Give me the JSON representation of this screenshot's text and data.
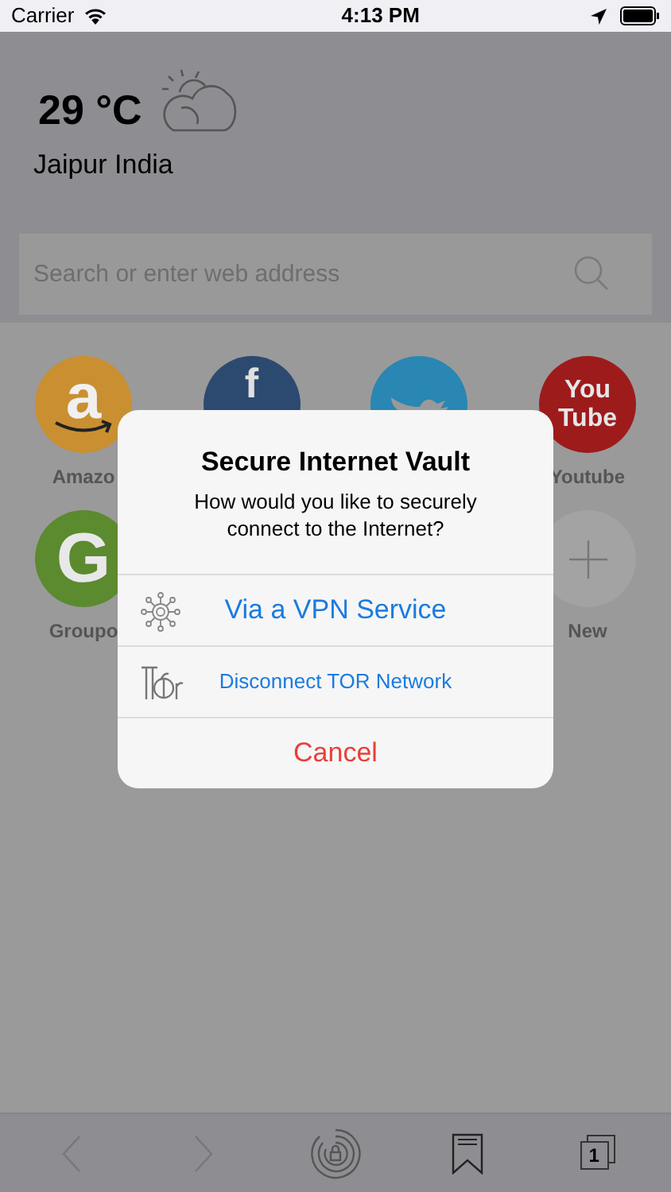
{
  "status_bar": {
    "carrier": "Carrier",
    "time": "4:13 PM"
  },
  "weather": {
    "temperature": "29 °C",
    "location": "Jaipur India"
  },
  "search": {
    "placeholder": "Search or enter web address"
  },
  "speed_dial": {
    "row_1": [
      {
        "kind": "amazon",
        "label": "Amazo",
        "logo_text": "a",
        "color": "#c98f31"
      },
      {
        "kind": "facebook",
        "logo_text": "f",
        "color": "#2c4a70"
      },
      {
        "kind": "twitter",
        "color": "#2a86b2"
      },
      {
        "kind": "youtube",
        "label": "Youtube",
        "logo_text": "You Tube",
        "color": "#9e1b1c"
      }
    ],
    "row_2": [
      {
        "kind": "groupon",
        "label": "Groupo",
        "logo_text": "G",
        "color": "#5c8a2e"
      },
      {
        "kind": "add",
        "label": "New"
      }
    ]
  },
  "dialog": {
    "title": "Secure Internet Vault",
    "message": "How would you like to securely connect to the Internet?",
    "actions": [
      {
        "kind": "vpn",
        "label": "Via a VPN Service"
      },
      {
        "kind": "tor",
        "label": "Disconnect TOR Network"
      },
      {
        "kind": "cancel",
        "label": "Cancel"
      }
    ]
  },
  "toolbar": {
    "back_disabled": true,
    "forward_disabled": true,
    "tab_count": "1"
  }
}
